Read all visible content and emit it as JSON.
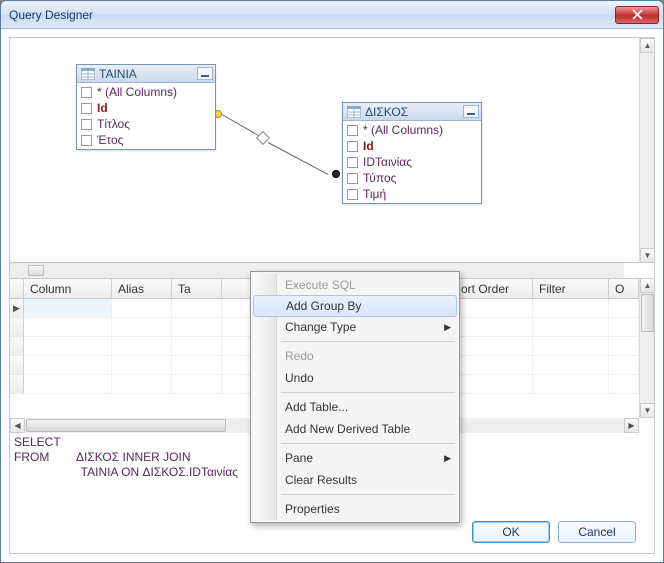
{
  "window": {
    "title": "Query Designer"
  },
  "tables": {
    "t1": {
      "name": "ΤΑΙΝΙΑ",
      "cols": {
        "all": "* (All Columns)",
        "c1": "Id",
        "c2": "Τίτλος",
        "c3": "Έτος"
      }
    },
    "t2": {
      "name": "ΔΙΣΚΟΣ",
      "cols": {
        "all": "* (All Columns)",
        "c1": "Id",
        "c2": "IDΤαινίας",
        "c3": "Τύπος",
        "c4": "Τιμή"
      }
    }
  },
  "grid": {
    "headers": {
      "column": "Column",
      "alias": "Alias",
      "table": "Ta",
      "output": "",
      "sortType": "",
      "sortOrder": "ort Order",
      "filter": "Filter",
      "or": "O"
    }
  },
  "sql": {
    "l1": "SELECT",
    "l2": "FROM        ΔΙΣΚΟΣ INNER JOIN",
    "l3": "                    ΤΑΙΝΙΑ ON ΔΙΣΚΟΣ.IDΤαινίας"
  },
  "menu": {
    "execute": "Execute SQL",
    "addgroupby": "Add Group By",
    "changetype": "Change Type",
    "redo": "Redo",
    "undo": "Undo",
    "addtable": "Add Table...",
    "addderived": "Add New Derived Table",
    "pane": "Pane",
    "clearresults": "Clear Results",
    "properties": "Properties"
  },
  "buttons": {
    "ok": "OK",
    "cancel": "Cancel"
  }
}
